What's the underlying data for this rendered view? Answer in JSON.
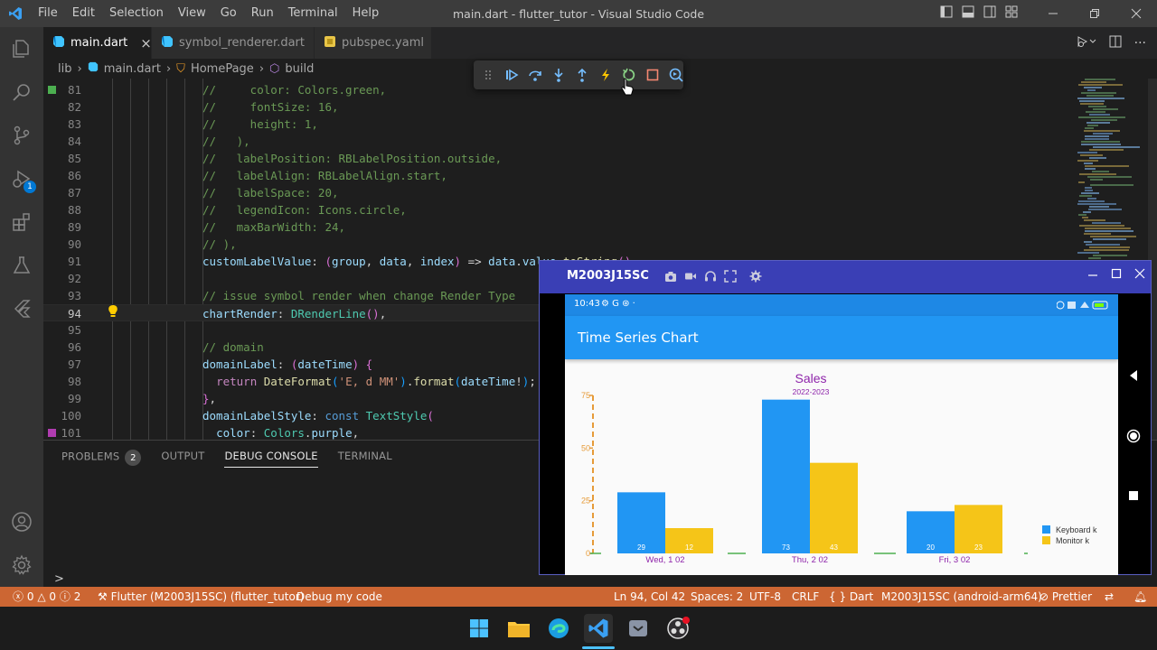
{
  "titlebar": {
    "menu": [
      "File",
      "Edit",
      "Selection",
      "View",
      "Go",
      "Run",
      "Terminal",
      "Help"
    ],
    "window_title": "main.dart - flutter_tutor - Visual Studio Code"
  },
  "activitybar": {
    "debug_badge": "1"
  },
  "tabs": [
    {
      "label": "main.dart",
      "active": true,
      "close": "×"
    },
    {
      "label": "symbol_renderer.dart",
      "active": false
    },
    {
      "label": "pubspec.yaml",
      "active": false
    }
  ],
  "breadcrumb": [
    "lib",
    "main.dart",
    "HomePage",
    "build"
  ],
  "editor": {
    "lines": [
      {
        "n": "81",
        "html": "<span class='c-cmt'>//     color: Colors.green,</span>"
      },
      {
        "n": "82",
        "html": "<span class='c-cmt'>//     fontSize: 16,</span>"
      },
      {
        "n": "83",
        "html": "<span class='c-cmt'>//     height: 1,</span>"
      },
      {
        "n": "84",
        "html": "<span class='c-cmt'>//   ),</span>"
      },
      {
        "n": "85",
        "html": "<span class='c-cmt'>//   labelPosition: RBLabelPosition.outside,</span>"
      },
      {
        "n": "86",
        "html": "<span class='c-cmt'>//   labelAlign: RBLabelAlign.start,</span>"
      },
      {
        "n": "87",
        "html": "<span class='c-cmt'>//   labelSpace: 20,</span>"
      },
      {
        "n": "88",
        "html": "<span class='c-cmt'>//   legendIcon: Icons.circle,</span>"
      },
      {
        "n": "89",
        "html": "<span class='c-cmt'>//   maxBarWidth: 24,</span>"
      },
      {
        "n": "90",
        "html": "<span class='c-cmt'>// ),</span>"
      },
      {
        "n": "91",
        "html": "<span class='c-prop'>customLabelValue</span><span class='c-pun'>: </span><span class='c-br2'>(</span><span class='c-prop'>group</span><span class='c-pun'>, </span><span class='c-prop'>data</span><span class='c-pun'>, </span><span class='c-prop'>index</span><span class='c-br2'>)</span><span class='c-pun'> =&gt; </span><span class='c-prop'>data</span><span class='c-pun'>.</span><span class='c-prop'>value</span><span class='c-pun'>.</span><span class='c-fn'>toString</span><span class='c-br2'>()</span><span class='c-pun'>,</span>"
      },
      {
        "n": "92",
        "html": ""
      },
      {
        "n": "93",
        "html": "<span class='c-cmt'>// issue symbol render when change Render Type</span>"
      },
      {
        "n": "94",
        "html": "<span class='c-prop'>chartRender</span><span class='c-pun'>: </span><span class='c-type'>DRenderLine</span><span class='c-br2'>()</span><span class='c-pun'>,</span>",
        "current": true
      },
      {
        "n": "95",
        "html": ""
      },
      {
        "n": "96",
        "html": "<span class='c-cmt'>// domain</span>"
      },
      {
        "n": "97",
        "html": "<span class='c-prop'>domainLabel</span><span class='c-pun'>: </span><span class='c-br2'>(</span><span class='c-prop'>dateTime</span><span class='c-br2'>)</span><span class='c-pun'> </span><span class='c-br2'>{</span>"
      },
      {
        "n": "98",
        "html": "  <span class='c-ctl'>return</span><span class='c-pun'> </span><span class='c-fn'>DateFormat</span><span class='c-br3'>(</span><span class='c-str'>'E, d MM'</span><span class='c-br3'>)</span><span class='c-pun'>.</span><span class='c-fn'>format</span><span class='c-br3'>(</span><span class='c-prop'>dateTime</span><span class='c-pun'>!</span><span class='c-br3'>)</span><span class='c-pun'>;</span>"
      },
      {
        "n": "99",
        "html": "<span class='c-br2'>}</span><span class='c-pun'>,</span>"
      },
      {
        "n": "100",
        "html": "<span class='c-prop'>domainLabelStyle</span><span class='c-pun'>: </span><span class='c-kw'>const</span><span class='c-pun'> </span><span class='c-type'>TextStyle</span><span class='c-br2'>(</span>"
      },
      {
        "n": "101",
        "html": "  <span class='c-prop'>color</span><span class='c-pun'>: </span><span class='c-type'>Colors</span><span class='c-pun'>.</span><span class='c-prop'>purple</span><span class='c-pun'>,</span>"
      }
    ]
  },
  "panel": {
    "tabs": [
      "PROBLEMS",
      "OUTPUT",
      "DEBUG CONSOLE",
      "TERMINAL"
    ],
    "problems_count": "2",
    "active_tab": "DEBUG CONSOLE",
    "prompt": ">"
  },
  "statusbar": {
    "errors": "0",
    "warnings": "0",
    "infos": "2",
    "device": "Flutter (M2003J15SC) (flutter_tutor)",
    "debug": "Debug my code",
    "position": "Ln 94, Col 42",
    "spaces": "Spaces: 2",
    "encoding": "UTF-8",
    "eol": "CRLF",
    "language": "Dart",
    "target": "M2003J15SC (android-arm64)",
    "formatter": "Prettier",
    "language_prefix": "{ }"
  },
  "emulator": {
    "device_name": "M2003J15SC",
    "phone_time": "10:43",
    "app_title": "Time Series Chart",
    "status_icons": "⚙ G ⊛ ·"
  },
  "colors": {
    "keyboard": "#2196f3",
    "monitor": "#f5c518",
    "title": "#8e24aa",
    "axis": "#e69b39",
    "baseline": "#4caf50",
    "statusbar": "#cc6633"
  },
  "chart_data": {
    "type": "bar",
    "title": "Sales",
    "subtitle": "2022-2023",
    "categories": [
      "Wed, 1 02",
      "Thu, 2 02",
      "Fri, 3 02"
    ],
    "series": [
      {
        "name": "Keyboard k",
        "values": [
          29,
          73,
          20
        ]
      },
      {
        "name": "Monitor k",
        "values": [
          12,
          43,
          23
        ]
      }
    ],
    "y_ticks": [
      0,
      25,
      50,
      75
    ],
    "ylim": [
      0,
      75
    ],
    "legend_position": "bottom-right"
  }
}
